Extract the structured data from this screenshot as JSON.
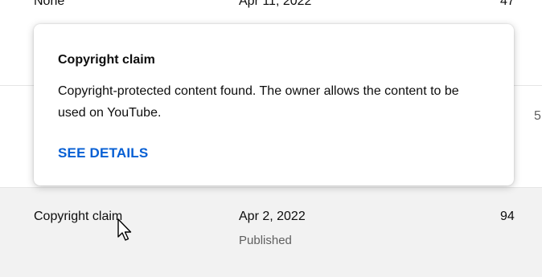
{
  "rows": {
    "top": {
      "restriction": "None",
      "date": "Apr 11, 2022",
      "views": "47"
    },
    "middle": {
      "views": "5"
    },
    "hovered": {
      "restriction": "Copyright claim",
      "date": "Apr 2, 2022",
      "status": "Published",
      "views": "94"
    }
  },
  "popup": {
    "title": "Copyright claim",
    "body": "Copyright-protected content found. The owner allows the content to be used on YouTube.",
    "link_label": "SEE DETAILS",
    "link_color": "#065fd4"
  },
  "cursor": {
    "icon": "arrow-pointer-icon"
  }
}
